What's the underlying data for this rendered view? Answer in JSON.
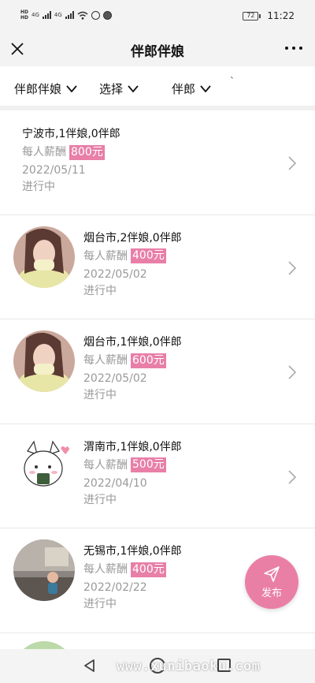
{
  "status_bar": {
    "network_left": "HD",
    "network_left2": "HD",
    "signal1_label": "4G",
    "signal2_label": "4G",
    "battery": "72",
    "time": "11:22"
  },
  "header": {
    "title": "伴郎伴娘",
    "close_icon": "close-icon",
    "more_icon": "more-icon"
  },
  "filters": [
    {
      "label": "伴郎伴娘"
    },
    {
      "label": "选择"
    },
    {
      "label": "伴郎"
    }
  ],
  "filter_extra_mark": "`",
  "salary_label": "每人薪酬",
  "items": [
    {
      "location": "宁波市,1伴娘,0伴郎",
      "price": "800元",
      "date": "2022/05/11",
      "status": "进行中",
      "avatar": "none"
    },
    {
      "location": "烟台市,2伴娘,0伴郎",
      "price": "400元",
      "date": "2022/05/02",
      "status": "进行中",
      "avatar": "photo-woman"
    },
    {
      "location": "烟台市,1伴娘,0伴郎",
      "price": "600元",
      "date": "2022/05/02",
      "status": "进行中",
      "avatar": "photo-woman"
    },
    {
      "location": "渭南市,1伴娘,0伴郎",
      "price": "500元",
      "date": "2022/04/10",
      "status": "进行中",
      "avatar": "cartoon-cat"
    },
    {
      "location": "无锡市,1伴娘,0伴郎",
      "price": "400元",
      "date": "2022/02/22",
      "status": "进行中",
      "avatar": "photo-room"
    }
  ],
  "fab": {
    "label": "发布",
    "icon": "send-icon"
  },
  "watermark": "www.xunibaoku.com",
  "colors": {
    "accent_pink": "#e87fa7",
    "fab_pink": "#ea7fa6"
  }
}
